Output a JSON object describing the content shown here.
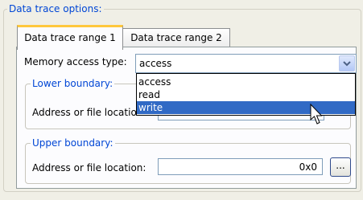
{
  "group_title": "Data trace options:",
  "tabs": [
    {
      "label": "Data trace range 1",
      "active": true
    },
    {
      "label": "Data trace range 2",
      "active": false
    }
  ],
  "memory_access": {
    "label": "Memory access type:",
    "value": "access",
    "options": [
      "access",
      "read",
      "write"
    ],
    "highlighted": "write"
  },
  "lower_boundary": {
    "title": "Lower boundary:",
    "address_label": "Address or file location:",
    "value": ""
  },
  "upper_boundary": {
    "title": "Upper boundary:",
    "address_label": "Address or file location:",
    "value": "0x0",
    "browse_label": "..."
  },
  "colors": {
    "accent_blue": "#0046d5",
    "selection": "#316ac5",
    "active_tab_highlight": "#ffc83c"
  }
}
